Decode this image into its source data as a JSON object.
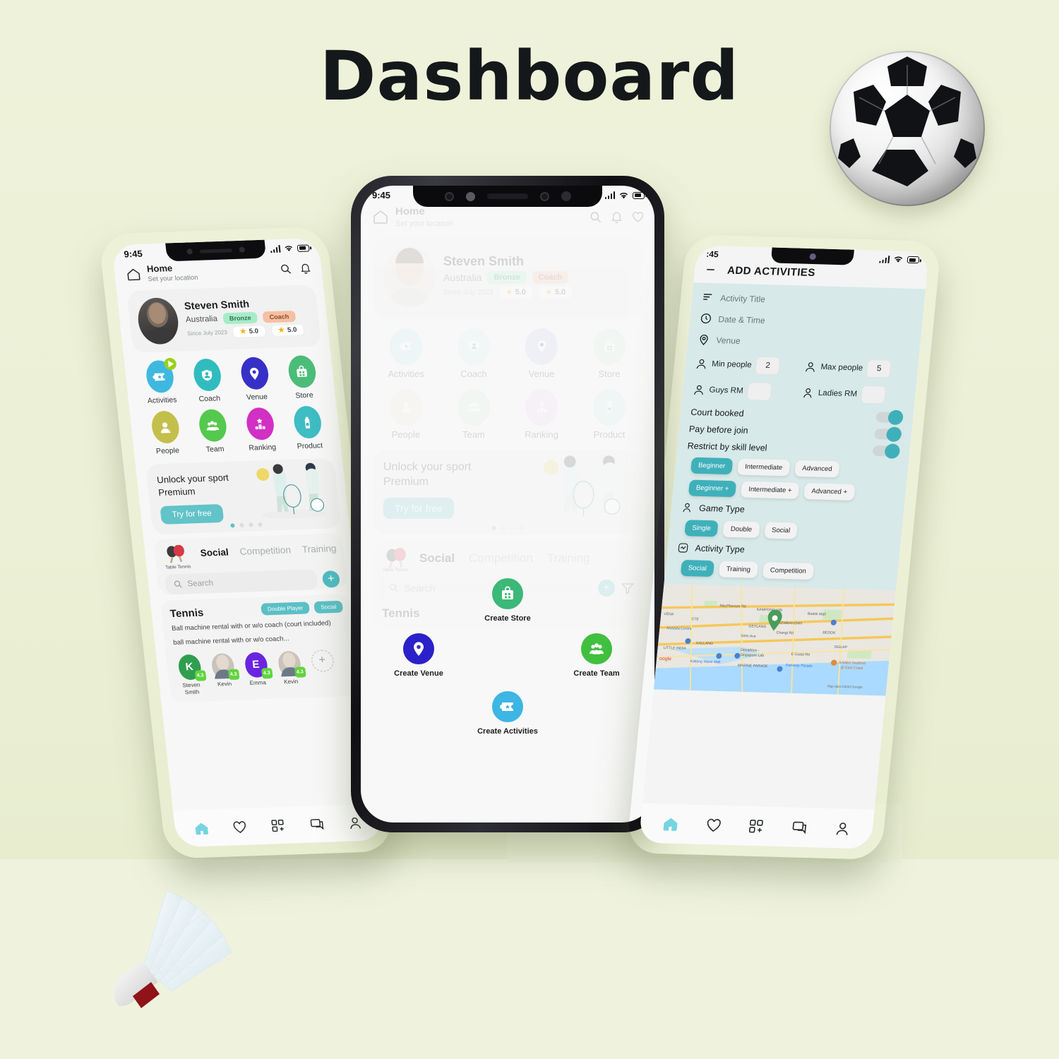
{
  "page": {
    "title": "Dashboard",
    "background_color": "#eef2da",
    "decorations": [
      "soccer-ball",
      "shuttlecock"
    ]
  },
  "left_phone": {
    "status": {
      "time": "9:45",
      "signal": "signal-icon",
      "wifi": "wifi-icon",
      "battery": "battery-icon"
    },
    "header": {
      "icon": "home-icon",
      "title": "Home",
      "subtitle": "Set your location",
      "actions": [
        "search-icon",
        "bell-icon"
      ]
    },
    "profile": {
      "name": "Steven Smith",
      "country": "Australia",
      "since": "Since July 2023",
      "badges": [
        {
          "label": "Bronze",
          "color": "#a7ecc8",
          "text_color": "#2e7350"
        },
        {
          "label": "Coach",
          "color": "#f6c0a2",
          "text_color": "#8a4a25"
        }
      ],
      "ratings": [
        "5.0",
        "5.0"
      ]
    },
    "menu_grid": [
      {
        "label": "Activities",
        "icon": "ticket-star-icon",
        "color": "#3fb8e0",
        "badge": "play-badge"
      },
      {
        "label": "Coach",
        "icon": "coach-shield-icon",
        "color": "#30bcbf"
      },
      {
        "label": "Venue",
        "icon": "map-pin-icon",
        "color": "#3730c7"
      },
      {
        "label": "Store",
        "icon": "store-bag-icon",
        "color": "#4bbd79"
      },
      {
        "label": "People",
        "icon": "person-icon",
        "color": "#c3bf4b"
      },
      {
        "label": "Team",
        "icon": "team-group-icon",
        "color": "#55c94e"
      },
      {
        "label": "Ranking",
        "icon": "podium-star-icon",
        "color": "#d22fc4"
      },
      {
        "label": "Product",
        "icon": "bottle-icon",
        "color": "#3fbcc4"
      }
    ],
    "promo": {
      "line1": "Unlock your sport",
      "line2": "Premium",
      "button": "Try for free",
      "dots": 4,
      "active_dot": 0
    },
    "tabs_section": {
      "sport_icon": "table-tennis-icon",
      "sport_name": "Table Tennis",
      "tabs": [
        {
          "label": "Social",
          "active": true
        },
        {
          "label": "Competition",
          "active": false
        },
        {
          "label": "Training",
          "active": false
        }
      ],
      "search_placeholder": "Search",
      "add_button": "+"
    },
    "activity_card": {
      "title": "Tennis",
      "chips": [
        "Double Player",
        "Social"
      ],
      "desc_line1": "Ball machine rental with or w/o coach (court included)",
      "desc_line2": "ball machine rental with or w/o coach...",
      "participants": [
        {
          "name": "Steven Smith",
          "initial": "K",
          "rating": "4.3",
          "color": "#2f9e4f",
          "type": "initial"
        },
        {
          "name": "Kevin",
          "initial": "",
          "rating": "4.3",
          "color": "#c9c3bb",
          "type": "photo"
        },
        {
          "name": "Emma",
          "initial": "E",
          "rating": "4.3",
          "color": "#6a24e0",
          "type": "initial"
        },
        {
          "name": "Kevin",
          "initial": "",
          "rating": "4.3",
          "color": "#c9c3bb",
          "type": "photo"
        }
      ],
      "add_participant": "+"
    },
    "bottom_nav": [
      {
        "icon": "home-icon",
        "active": true,
        "color": "#76d4e0"
      },
      {
        "icon": "heart-icon",
        "active": false
      },
      {
        "icon": "grid-plus-icon",
        "active": false
      },
      {
        "icon": "chat-icon",
        "active": false
      },
      {
        "icon": "profile-icon",
        "active": false
      }
    ]
  },
  "center_phone": {
    "status": {
      "time": "9:45"
    },
    "header": {
      "icon": "home-icon",
      "title": "Home",
      "subtitle": "Set your location",
      "actions": [
        "search-icon",
        "bell-icon",
        "heart-icon"
      ]
    },
    "profile": {
      "name": "Steven Smith",
      "country": "Australia",
      "since": "Since July 2023",
      "badges": [
        {
          "label": "Bronze"
        },
        {
          "label": "Coach"
        }
      ],
      "ratings": [
        "5.0",
        "5.0"
      ]
    },
    "menu_grid": [
      {
        "label": "Activities",
        "icon": "ticket-star-icon"
      },
      {
        "label": "Coach",
        "icon": "coach-shield-icon"
      },
      {
        "label": "Venue",
        "icon": "map-pin-icon"
      },
      {
        "label": "Store",
        "icon": "store-bag-icon"
      },
      {
        "label": "People",
        "icon": "person-icon"
      },
      {
        "label": "Team",
        "icon": "team-group-icon"
      },
      {
        "label": "Ranking",
        "icon": "podium-star-icon"
      },
      {
        "label": "Product",
        "icon": "bottle-icon"
      }
    ],
    "promo": {
      "line1": "Unlock your sport",
      "line2": "Premium",
      "button": "Try for free"
    },
    "tabs_section": {
      "sport_name": "Table Tennis",
      "tabs": [
        "Social",
        "Competition",
        "Training"
      ],
      "search_placeholder": "Search"
    },
    "activity_title": "Tennis",
    "create_menu": [
      {
        "label": "Create Store",
        "icon": "store-bag-icon",
        "color": "#3cb878"
      },
      {
        "label": "Create Venue",
        "icon": "map-pin-icon",
        "color": "#2a21c9"
      },
      {
        "label": "Create Team",
        "icon": "team-group-icon",
        "color": "#41bf3f"
      },
      {
        "label": "Create Activities",
        "icon": "ticket-star-icon",
        "color": "#3db6e5"
      }
    ]
  },
  "right_phone": {
    "status": {
      "time": ":45"
    },
    "title": "ADD ACTIVITIES",
    "back_icon": "back-arrow-icon",
    "fields": [
      {
        "icon": "lines-icon",
        "placeholder": "Activity Title"
      },
      {
        "icon": "clock-icon",
        "placeholder": "Date & Time"
      },
      {
        "icon": "map-pin-icon",
        "placeholder": "Venue"
      }
    ],
    "people": [
      {
        "icon": "person-badge-icon",
        "label": "Min people",
        "value": "2"
      },
      {
        "icon": "person-badge-icon",
        "label": "Max people",
        "value": "5"
      },
      {
        "icon": "guy-icon",
        "label": "Guys RM",
        "value": ""
      },
      {
        "icon": "lady-icon",
        "label": "Ladies RM",
        "value": ""
      }
    ],
    "toggles": [
      {
        "label": "Court booked",
        "on": true
      },
      {
        "label": "Pay before join",
        "on": true
      },
      {
        "label": "Restrict by skill level",
        "on": true
      }
    ],
    "skill_levels_row1": [
      {
        "label": "Beginner",
        "selected": true
      },
      {
        "label": "Intermediate",
        "selected": false
      },
      {
        "label": "Advanced",
        "selected": false
      }
    ],
    "skill_levels_row2": [
      {
        "label": "Beginner +",
        "selected": true
      },
      {
        "label": "Intermediate +",
        "selected": false
      },
      {
        "label": "Advanced +",
        "selected": false
      }
    ],
    "game_type": {
      "icon": "person-icon",
      "label": "Game Type",
      "options": [
        {
          "label": "Single",
          "selected": true
        },
        {
          "label": "Double",
          "selected": false
        },
        {
          "label": "Social",
          "selected": false
        }
      ]
    },
    "activity_type": {
      "icon": "pulse-icon",
      "label": "Activity Type",
      "options": [
        {
          "label": "Social",
          "selected": true
        },
        {
          "label": "Training",
          "selected": false
        },
        {
          "label": "Competition",
          "selected": false
        }
      ]
    },
    "map": {
      "attribution": "Map data ©2023 Google",
      "logo": "Google",
      "labels": [
        "MacPherson Rd",
        "KAMPONG UBI",
        "Bedok Mall",
        "KEMBANGAN",
        "BEDOK",
        "GEYLANG",
        "Changi Rd",
        "SIGLAP",
        "Mustafa Centre",
        "KALLANG",
        "LITTLE INDIA",
        "Decathlon - Singapore Lab",
        "E Coast Rd",
        "Kallang Wave Mall",
        "MARINE PARADE",
        "Parkway Parade",
        "JUMBO Seafood @ East Coast",
        "Sims Ave",
        "VENA",
        "CTE"
      ]
    },
    "bottom_nav": [
      {
        "icon": "home-icon",
        "active": true
      },
      {
        "icon": "heart-icon",
        "active": false
      },
      {
        "icon": "grid-plus-icon",
        "active": false
      },
      {
        "icon": "chat-icon",
        "active": false
      },
      {
        "icon": "profile-icon",
        "active": false
      }
    ]
  }
}
